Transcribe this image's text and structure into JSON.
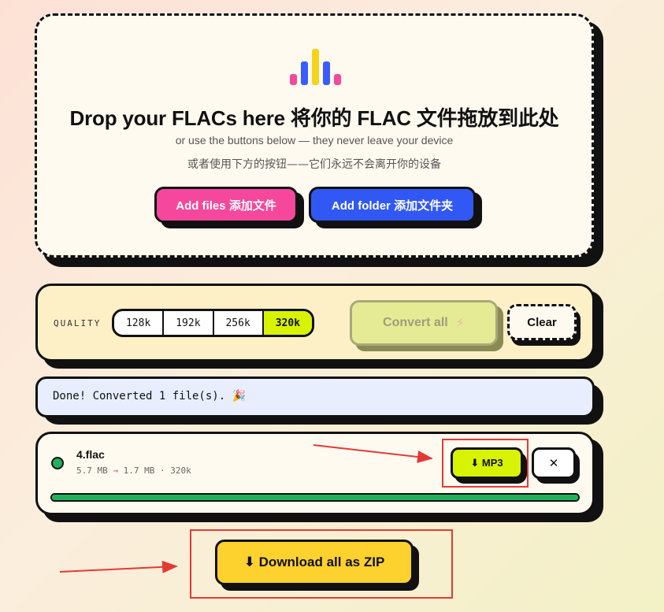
{
  "dropzone": {
    "title": "Drop your FLACs here 将你的 FLAC 文件拖放到此处",
    "subtitle_en": "or use the buttons below — they never leave your device",
    "subtitle_zh": "或者使用下方的按钮——它们永远不会离开你的设备",
    "add_files": "Add files 添加文件",
    "add_folder": "Add folder 添加文件夹",
    "logo_colors": [
      "#f5479b",
      "#3a5cff",
      "#f5d31c",
      "#f5479b"
    ]
  },
  "quality": {
    "label": "QUALITY",
    "options": [
      "128k",
      "192k",
      "256k",
      "320k"
    ],
    "selected": "320k",
    "convert_all": "Convert all",
    "convert_icon": "⚡",
    "clear": "Clear"
  },
  "status": {
    "message": "Done! Converted 1 file(s). 🎉"
  },
  "file": {
    "name": "4.flac",
    "size_from": "5.7 MB",
    "arrow": "→",
    "size_to": "1.7 MB",
    "bitrate": "320k",
    "status_color": "#22b15a",
    "progress": 1.0,
    "download_label": "⬇ MP3",
    "remove_label": "✕"
  },
  "zip": {
    "label": "⬇ Download all as ZIP"
  },
  "colors": {
    "pink": "#f5479b",
    "blue": "#3158f5",
    "lime": "#d8f300",
    "yellow": "#fdd12e",
    "annotation_red": "#e53935"
  }
}
